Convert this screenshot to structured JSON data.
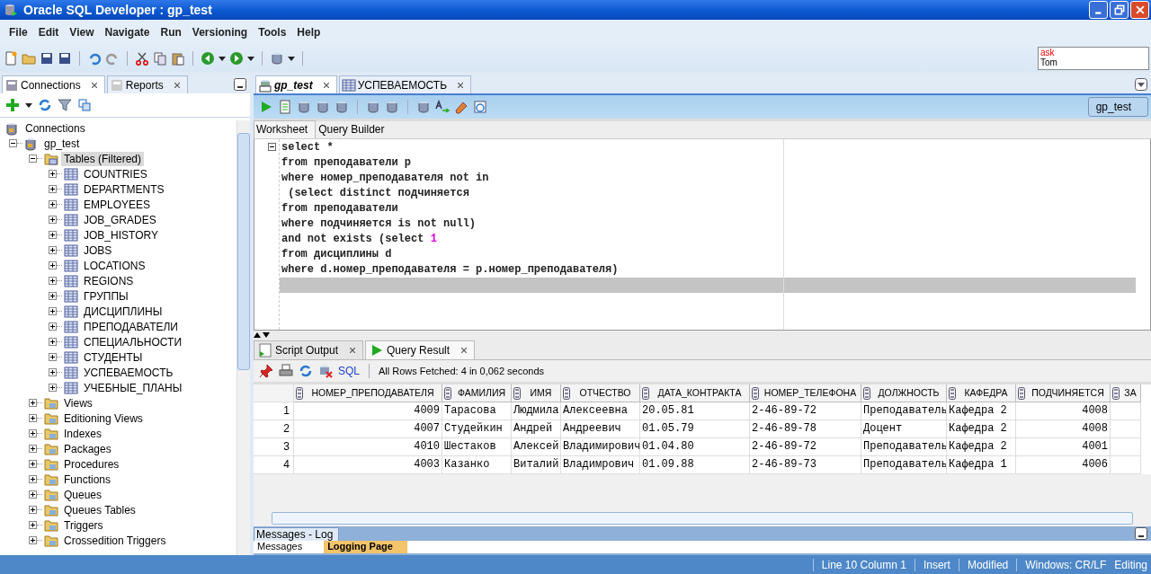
{
  "window": {
    "title": "Oracle SQL Developer : gp_test"
  },
  "menu": [
    {
      "label": "File"
    },
    {
      "label": "Edit"
    },
    {
      "label": "View"
    },
    {
      "label": "Navigate"
    },
    {
      "label": "Run"
    },
    {
      "label": "Versioning"
    },
    {
      "label": "Tools"
    },
    {
      "label": "Help"
    }
  ],
  "ask_tom": {
    "line_1": "ask",
    "line_2": "Tom"
  },
  "left_panel": {
    "tabs": [
      {
        "label": "Connections",
        "selected": true
      },
      {
        "label": "Reports",
        "selected": false
      }
    ],
    "tree": [
      {
        "label": "Connections",
        "kind": "connections",
        "selected": false,
        "children": [
          {
            "label": "gp_test",
            "kind": "connection",
            "expanded": true,
            "selected": false,
            "children": [
              {
                "label": "Tables (Filtered)",
                "kind": "tables",
                "expanded": true,
                "selected": true,
                "children": [
                  {
                    "label": "COUNTRIES",
                    "kind": "table",
                    "expanded": false,
                    "selected": false
                  },
                  {
                    "label": "DEPARTMENTS",
                    "kind": "table",
                    "expanded": false,
                    "selected": false
                  },
                  {
                    "label": "EMPLOYEES",
                    "kind": "table",
                    "expanded": false,
                    "selected": false
                  },
                  {
                    "label": "JOB_GRADES",
                    "kind": "table",
                    "expanded": false,
                    "selected": false
                  },
                  {
                    "label": "JOB_HISTORY",
                    "kind": "table",
                    "expanded": false,
                    "selected": false
                  },
                  {
                    "label": "JOBS",
                    "kind": "table",
                    "expanded": false,
                    "selected": false
                  },
                  {
                    "label": "LOCATIONS",
                    "kind": "table",
                    "expanded": false,
                    "selected": false
                  },
                  {
                    "label": "REGIONS",
                    "kind": "table",
                    "expanded": false,
                    "selected": false
                  },
                  {
                    "label": "ГРУППЫ",
                    "kind": "table",
                    "expanded": false,
                    "selected": false
                  },
                  {
                    "label": "ДИСЦИПЛИНЫ",
                    "kind": "table",
                    "expanded": false,
                    "selected": false
                  },
                  {
                    "label": "ПРЕПОДАВАТЕЛИ",
                    "kind": "table",
                    "expanded": false,
                    "selected": false
                  },
                  {
                    "label": "СПЕЦИАЛЬНОСТИ",
                    "kind": "table",
                    "expanded": false,
                    "selected": false
                  },
                  {
                    "label": "СТУДЕНТЫ",
                    "kind": "table",
                    "expanded": false,
                    "selected": false
                  },
                  {
                    "label": "УСПЕВАЕМОСТЬ",
                    "kind": "table",
                    "expanded": false,
                    "selected": false
                  },
                  {
                    "label": "УЧЕБНЫЕ_ПЛАНЫ",
                    "kind": "table",
                    "expanded": false,
                    "selected": false
                  }
                ]
              },
              {
                "label": "Views",
                "kind": "folder",
                "expanded": false,
                "selected": false
              },
              {
                "label": "Editioning Views",
                "kind": "folder",
                "expanded": false,
                "selected": false
              },
              {
                "label": "Indexes",
                "kind": "folder",
                "expanded": false,
                "selected": false
              },
              {
                "label": "Packages",
                "kind": "folder",
                "expanded": false,
                "selected": false
              },
              {
                "label": "Procedures",
                "kind": "folder",
                "expanded": false,
                "selected": false
              },
              {
                "label": "Functions",
                "kind": "folder",
                "expanded": false,
                "selected": false
              },
              {
                "label": "Queues",
                "kind": "folder",
                "expanded": false,
                "selected": false
              },
              {
                "label": "Queues Tables",
                "kind": "folder",
                "expanded": false,
                "selected": false
              },
              {
                "label": "Triggers",
                "kind": "folder",
                "expanded": false,
                "selected": false
              },
              {
                "label": "Crossedition Triggers",
                "kind": "folder",
                "expanded": false,
                "selected": false
              }
            ]
          }
        ]
      }
    ]
  },
  "editor": {
    "tabs": [
      {
        "label": "gp_test",
        "kind": "worksheet",
        "selected": true
      },
      {
        "label": "УСПЕВАЕМОСТЬ",
        "kind": "table",
        "selected": false
      }
    ],
    "connection": "gp_test",
    "sub_tabs": [
      {
        "label": "Worksheet",
        "selected": true
      },
      {
        "label": "Query Builder",
        "selected": false
      }
    ],
    "code": [
      [
        {
          "text": "select *"
        }
      ],
      [
        {
          "text": "from преподаватели p"
        }
      ],
      [
        {
          "text": "where номер_преподавателя not in"
        }
      ],
      [
        {
          "text": " (select distinct подчиняется"
        }
      ],
      [
        {
          "text": "from преподаватели"
        }
      ],
      [
        {
          "text": "where подчиняется is not null)"
        }
      ],
      [
        {
          "text": "and not exists (select "
        },
        {
          "text": "1",
          "kind": "number"
        }
      ],
      [
        {
          "text": "from дисциплины d"
        }
      ],
      [
        {
          "text": "where d.номер_преподавателя = p.номер_преподавателя)"
        }
      ]
    ]
  },
  "results": {
    "tabs": [
      {
        "label": "Script Output",
        "kind": "script",
        "selected": false
      },
      {
        "label": "Query Result",
        "kind": "query",
        "selected": true
      }
    ],
    "sql_link": "SQL",
    "fetch_status": "All Rows Fetched: 4 in 0,062 seconds",
    "table": {
      "columns": [
        {
          "label": "НОМЕР_ПРЕПОДАВАТЕЛЯ",
          "kind": "number"
        },
        {
          "label": "ФАМИЛИЯ",
          "kind": "text"
        },
        {
          "label": "ИМЯ",
          "kind": "text"
        },
        {
          "label": "ОТЧЕСТВО",
          "kind": "text"
        },
        {
          "label": "ДАТА_КОНТРАКТА",
          "kind": "text"
        },
        {
          "label": "НОМЕР_ТЕЛЕФОНА",
          "kind": "text"
        },
        {
          "label": "ДОЛЖНОСТЬ",
          "kind": "text"
        },
        {
          "label": "КАФЕДРА",
          "kind": "text"
        },
        {
          "label": "ПОДЧИНЯЕТСЯ",
          "kind": "number"
        },
        {
          "label": "ЗА",
          "kind": "text"
        }
      ],
      "rows": [
        {
          "number": "1",
          "cells": [
            "4009",
            "Тарасова",
            "Людмила",
            "Алексеевна",
            "20.05.81",
            "2-46-89-72",
            "Преподаватель",
            "Кафедра 2",
            "4008"
          ]
        },
        {
          "number": "2",
          "cells": [
            "4007",
            "Студейкин",
            "Андрей",
            "Андреевич",
            "01.05.79",
            "2-46-89-78",
            "Доцент",
            "Кафедра 2",
            "4008"
          ]
        },
        {
          "number": "3",
          "cells": [
            "4010",
            "Шестаков",
            "Алексей",
            "Владимирович",
            "01.04.80",
            "2-46-89-72",
            "Преподаватель",
            "Кафедра 2",
            "4001"
          ]
        },
        {
          "number": "4",
          "cells": [
            "4003",
            "Казанко",
            "Виталий",
            "Владимрович",
            "01.09.88",
            "2-46-89-73",
            "Преподаватель",
            "Кафедра 1",
            "4006"
          ]
        }
      ]
    }
  },
  "log": {
    "title": "Messages - Log",
    "tabs": [
      {
        "label": "Messages",
        "selected": false
      },
      {
        "label": "Logging Page",
        "selected": true
      }
    ]
  },
  "status_bar": [
    "Line 10 Column 1",
    "Insert",
    "Modified",
    "Windows: CR/LF",
    "Editing"
  ]
}
